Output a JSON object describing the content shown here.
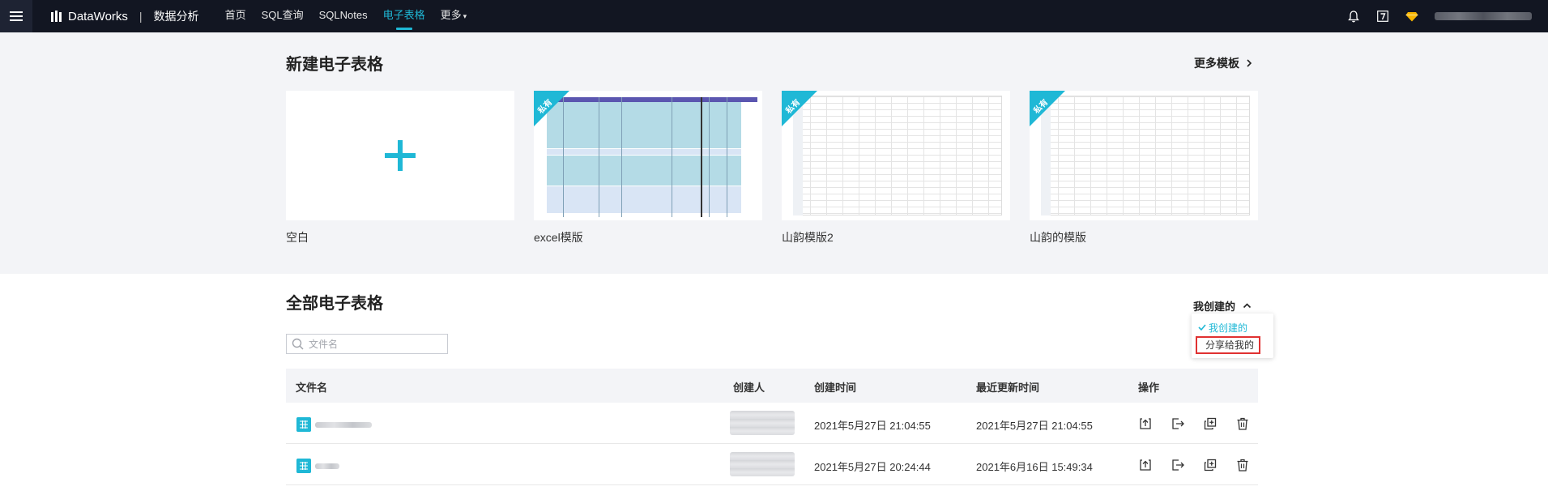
{
  "topbar": {
    "brand": "DataWorks",
    "separator": "|",
    "module": "数据分析",
    "nav": [
      {
        "label": "首页",
        "active": false
      },
      {
        "label": "SQL查询",
        "active": false
      },
      {
        "label": "SQLNotes",
        "active": false
      },
      {
        "label": "电子表格",
        "active": true
      },
      {
        "label": "更多",
        "active": false,
        "caret": "▾"
      }
    ],
    "icons": [
      "bell-icon",
      "help-icon",
      "diamond-icon"
    ],
    "accent_color": "#1fb8d6"
  },
  "templates": {
    "title": "新建电子表格",
    "more_label": "更多模板",
    "ribbon_label": "私有",
    "cards": [
      {
        "label": "空白",
        "kind": "blank"
      },
      {
        "label": "excel模版",
        "kind": "excel",
        "private": true
      },
      {
        "label": "山韵模版2",
        "kind": "sheet",
        "private": true
      },
      {
        "label": "山韵的模版",
        "kind": "sheet",
        "private": true
      }
    ]
  },
  "all_sheets": {
    "title": "全部电子表格",
    "filter_label": "我创建的",
    "filter_options": [
      {
        "label": "我创建的",
        "selected": true
      },
      {
        "label": "分享给我的",
        "selected": false
      }
    ],
    "search_placeholder": "文件名",
    "columns": [
      "文件名",
      "创建人",
      "创建时间",
      "最近更新时间",
      "操作"
    ],
    "rows": [
      {
        "created": "2021年5月27日 21:04:55",
        "updated": "2021年5月27日 21:04:55"
      },
      {
        "created": "2021年5月27日 20:24:44",
        "updated": "2021年6月16日 15:49:34"
      }
    ],
    "actions": [
      "share-icon",
      "export-icon",
      "copy-icon",
      "delete-icon"
    ]
  }
}
